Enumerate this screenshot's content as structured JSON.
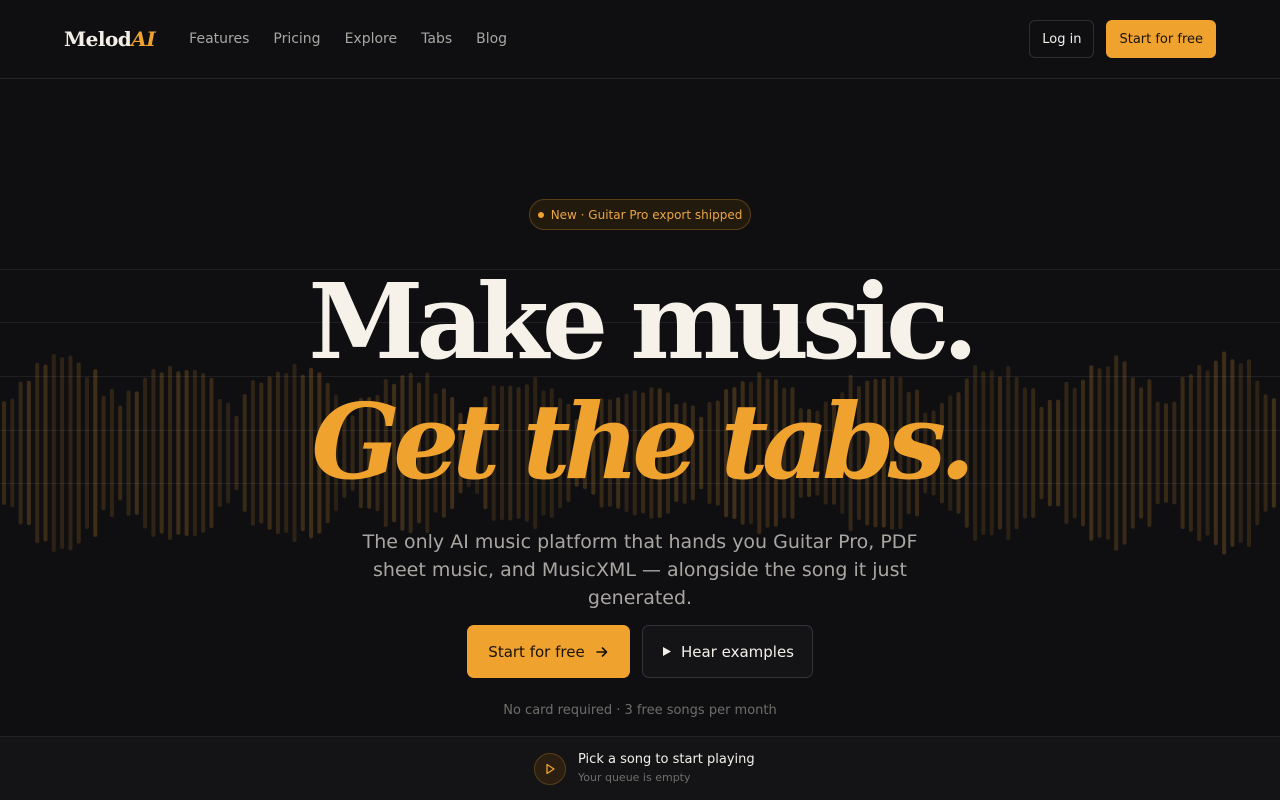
{
  "nav": {
    "logo_main": "Melod",
    "logo_accent": "AI",
    "links": [
      "Features",
      "Pricing",
      "Explore",
      "Tabs",
      "Blog"
    ],
    "login_label": "Log in",
    "start_label": "Start for free"
  },
  "hero": {
    "badge": "New · Guitar Pro export shipped",
    "headline_line1": "Make music.",
    "headline_line2": "Get the tabs.",
    "subtitle": "The only AI music platform that hands you Guitar Pro, PDF sheet music, and MusicXML — alongside the song it just generated.",
    "primary_cta": "Start for free",
    "secondary_cta": "Hear examples",
    "note": "No card required · 3 free songs per month"
  },
  "player": {
    "title": "Pick a song to start playing",
    "subtitle": "Your queue is empty"
  },
  "colors": {
    "background": "#0f0f12",
    "accent": "#f0a22e",
    "text": "#f2efe9",
    "muted": "#a9a6a1"
  },
  "icons": {
    "primary_cta": "arrow-right-icon",
    "secondary_cta": "play-icon",
    "player": "play-circle-icon",
    "badge": "dot-icon"
  }
}
